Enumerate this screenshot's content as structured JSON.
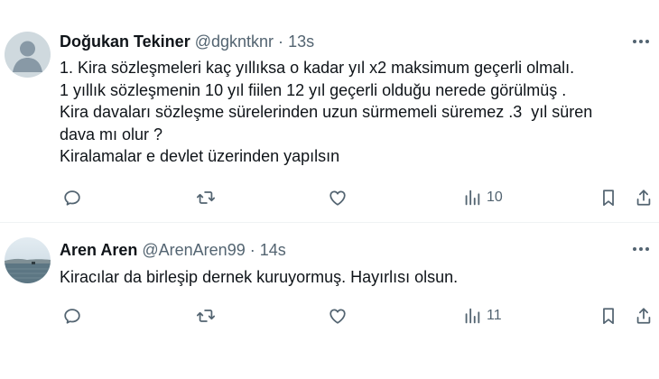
{
  "tweets": [
    {
      "author": {
        "name": "Doğukan Tekiner",
        "handle": "@dgkntknr"
      },
      "dot": "·",
      "time": "13s",
      "lines": [
        "1. Kira sözleşmeleri kaç yıllıksa o kadar yıl x2 maksimum geçerli olmalı.",
        "1 yıllık sözleşmenin 10 yıl fiilen 12 yıl geçerli olduğu nerede görülmüş .",
        "Kira davaları sözleşme sürelerinden uzun sürmemeli süremez .3  yıl süren",
        "dava mı olur ?",
        "Kiralamalar e devlet üzerinden yapılsın"
      ],
      "views": "10",
      "icons": [
        "reply-icon",
        "retweet-icon",
        "like-icon",
        "views-icon",
        "bookmark-icon",
        "share-icon"
      ]
    },
    {
      "author": {
        "name": "Aren Aren",
        "handle": "@ArenAren99"
      },
      "dot": "·",
      "time": "14s",
      "lines": [
        "Kiracılar da birleşip dernek kuruyormuş. Hayırlısı olsun."
      ],
      "views": "11",
      "icons": [
        "reply-icon",
        "retweet-icon",
        "like-icon",
        "views-icon",
        "bookmark-icon",
        "share-icon"
      ]
    }
  ],
  "colors": {
    "text": "#0f1419",
    "secondary": "#536471",
    "divider": "#eff3f4"
  }
}
